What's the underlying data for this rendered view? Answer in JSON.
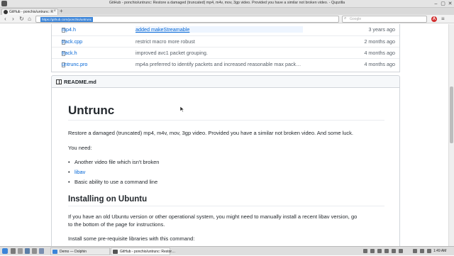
{
  "window": {
    "title": "GitHub - ponchio/untrunc: Restore a damaged (truncated) mp4, m4v, mov, 3gp video. Provided you have a similar not broken video. - Qupzilla",
    "minimize": "–",
    "maximize": "▢",
    "close": "✕"
  },
  "browser": {
    "tab_label": "GitHub - ponchio/untrunc: Res…",
    "tab_close": "×",
    "new_tab": "+",
    "back": "‹",
    "forward": "›",
    "reload": "↻",
    "home": "⌂",
    "url": "https://github.com/ponchio/untrunc",
    "search_placeholder": "Google",
    "search_icon": "⌕",
    "menu": "≡",
    "extension": "A"
  },
  "files": [
    {
      "name": "mp4.h",
      "message": "added makeStreamable",
      "age": "3 years ago",
      "message_is_link": true
    },
    {
      "name": "track.cpp",
      "message": "restrict macro more robust",
      "age": "2 months ago",
      "message_is_link": false
    },
    {
      "name": "track.h",
      "message": "improved avc1 packet grouping.",
      "age": "4 months ago",
      "message_is_link": false
    },
    {
      "name": "untrunc.pro",
      "message": "mp4a preferred to identify packets and increased reasonable max packe…",
      "age": "4 months ago",
      "message_is_link": false
    }
  ],
  "readme": {
    "filename": "README.md",
    "title": "Untrunc",
    "intro": "Restore a damaged (truncated) mp4, m4v, mov, 3gp video. Provided you have a similar not broken video. And some luck.",
    "you_need": "You need:",
    "needs": [
      "Another video file which isn't broken",
      "libav",
      "Basic ability to use a command line"
    ],
    "install_heading": "Installing on Ubuntu",
    "install_p1_line1": "If you have an old Ubuntu version or other operational system, you might need to manually install a recent libav version, go",
    "install_p1_line2": "to the bottom of the page for instructions.",
    "install_p2": "Install some pre-requisite libraries with this command:"
  },
  "taskbar": {
    "items": [
      "Demo — Dolphin",
      "GitHub - ponchio/untrunc: Restor…"
    ],
    "clock": "1:49 AM"
  },
  "colors": {
    "link": "#0366d6",
    "text": "#24292e",
    "muted": "#586069",
    "url_highlight": "#3b84d8"
  }
}
